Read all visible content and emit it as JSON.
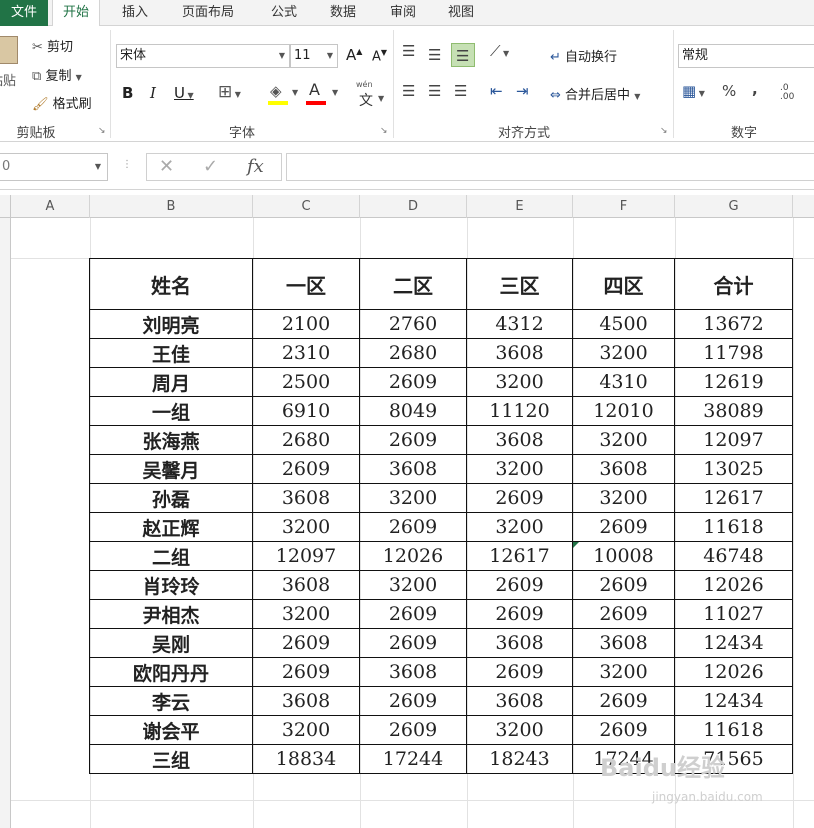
{
  "tabs": {
    "file": "文件",
    "home": "开始",
    "insert": "插入",
    "layout": "页面布局",
    "formulas": "公式",
    "data": "数据",
    "review": "审阅",
    "view": "视图"
  },
  "ribbon": {
    "clipboard": {
      "paste_label": "粘贴",
      "cut_label": "剪切",
      "copy_label": "复制",
      "format_painter_label": "格式刷",
      "group_label": "剪贴板"
    },
    "font": {
      "font_name": "宋体",
      "font_size": "11",
      "bold": "B",
      "italic": "I",
      "underline": "U",
      "grow": "A",
      "shrink": "A",
      "font_color_letter": "A",
      "phonetic": "文",
      "phonetic_top": "wén",
      "group_label": "字体",
      "fill_color": "#ffff00",
      "font_color": "#ff0000"
    },
    "alignment": {
      "wrap_text_label": "自动换行",
      "merge_center_label": "合并后居中",
      "group_label": "对齐方式"
    },
    "number": {
      "format": "常规",
      "percent": "%",
      "comma": ",",
      "group_label": "数字"
    }
  },
  "formula_bar": {
    "name_box": "0",
    "cancel_symbol": "✕",
    "enter_symbol": "✓",
    "fx": "fx",
    "formula": ""
  },
  "columns": [
    "A",
    "B",
    "C",
    "D",
    "E",
    "F",
    "G"
  ],
  "table": {
    "headers": [
      "姓名",
      "一区",
      "二区",
      "三区",
      "四区",
      "合计"
    ],
    "rows": [
      [
        "刘明亮",
        "2100",
        "2760",
        "4312",
        "4500",
        "13672"
      ],
      [
        "王佳",
        "2310",
        "2680",
        "3608",
        "3200",
        "11798"
      ],
      [
        "周月",
        "2500",
        "2609",
        "3200",
        "4310",
        "12619"
      ],
      [
        "一组",
        "6910",
        "8049",
        "11120",
        "12010",
        "38089"
      ],
      [
        "张海燕",
        "2680",
        "2609",
        "3608",
        "3200",
        "12097"
      ],
      [
        "吴馨月",
        "2609",
        "3608",
        "3200",
        "3608",
        "13025"
      ],
      [
        "孙磊",
        "3608",
        "3200",
        "2609",
        "3200",
        "12617"
      ],
      [
        "赵正辉",
        "3200",
        "2609",
        "3200",
        "2609",
        "11618"
      ],
      [
        "二组",
        "12097",
        "12026",
        "12617",
        "10008",
        "46748"
      ],
      [
        "肖玲玲",
        "3608",
        "3200",
        "2609",
        "2609",
        "12026"
      ],
      [
        "尹相杰",
        "3200",
        "2609",
        "2609",
        "2609",
        "11027"
      ],
      [
        "吴刚",
        "2609",
        "2609",
        "3608",
        "3608",
        "12434"
      ],
      [
        "欧阳丹丹",
        "2609",
        "3608",
        "2609",
        "3200",
        "12026"
      ],
      [
        "李云",
        "3608",
        "2609",
        "3608",
        "2609",
        "12434"
      ],
      [
        "谢会平",
        "3200",
        "2609",
        "3200",
        "2609",
        "11618"
      ],
      [
        "三组",
        "18834",
        "17244",
        "18243",
        "17244",
        "71565"
      ]
    ]
  },
  "watermark": {
    "brand": "Baidu经验",
    "url": "jingyan.baidu.com"
  },
  "colors": {
    "excel_green": "#217346",
    "grid_line": "#e2e2e2",
    "table_border": "#111111"
  }
}
